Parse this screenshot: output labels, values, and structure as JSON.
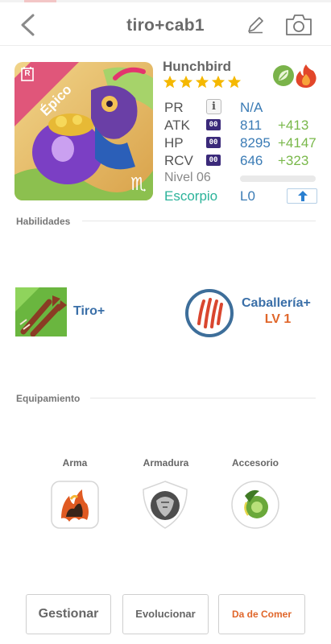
{
  "header": {
    "title": "tiro+cab1",
    "back_icon": "chevron-left-icon",
    "edit_icon": "pencil-icon",
    "camera_icon": "camera-icon"
  },
  "card": {
    "rarity_badge": "R",
    "ribbon": "Épico",
    "zodiac_symbol": "♏",
    "ribbon_color": "#e0567a"
  },
  "monster": {
    "name": "Hunchbird",
    "star_count": 5,
    "elements": [
      "leaf-icon",
      "fire-icon"
    ]
  },
  "stats": [
    {
      "label": "PR",
      "badge": "i",
      "value": "N/A",
      "bonus": ""
    },
    {
      "label": "ATK",
      "badge": "00",
      "value": "811",
      "bonus": "+413"
    },
    {
      "label": "HP",
      "badge": "00",
      "value": "8295",
      "bonus": "+4147"
    },
    {
      "label": "RCV",
      "badge": "00",
      "value": "646",
      "bonus": "+323"
    }
  ],
  "level": {
    "label": "Nivel 06",
    "progress": 0
  },
  "zodiac": {
    "label": "Escorpio",
    "value": "L0"
  },
  "skills": {
    "title": "Habilidades",
    "items": [
      {
        "name": "Tiro+",
        "icon": "arrows-skill-icon"
      },
      {
        "name": "Caballería+",
        "level": "LV 1",
        "icon": "claw-skill-icon"
      }
    ]
  },
  "equipment": {
    "title": "Equipamiento",
    "slots": [
      {
        "label": "Arma",
        "icon": "fire-claw-icon"
      },
      {
        "label": "Armadura",
        "icon": "steel-armor-icon"
      },
      {
        "label": "Accesorio",
        "icon": "green-leaf-orb-icon"
      }
    ]
  },
  "buttons": {
    "manage": "Gestionar",
    "evolve": "Evolucionar",
    "feed": "Da de Comer"
  },
  "colors": {
    "link_blue": "#3a7bb5",
    "bonus_green": "#79b84a",
    "accent_orange": "#e0662a",
    "zodiac_teal": "#2bb39a"
  }
}
